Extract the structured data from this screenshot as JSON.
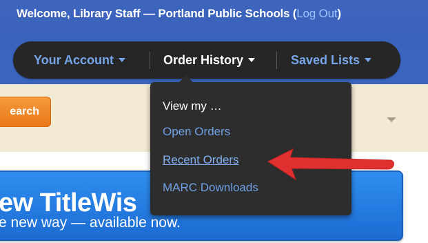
{
  "header": {
    "welcome_text": "Welcome, Library Staff — Portland Public Schools (",
    "logout_link": "Log Out",
    "close_paren": ")"
  },
  "nav": {
    "items": [
      {
        "label": "Your Account"
      },
      {
        "label": "Order History",
        "active": true
      },
      {
        "label": "Saved Lists"
      }
    ]
  },
  "dropdown": {
    "heading": "View my …",
    "items": [
      {
        "label": "Open Orders"
      },
      {
        "label": "Recent Orders",
        "highlighted": true
      },
      {
        "label": "MARC Downloads"
      }
    ]
  },
  "search": {
    "button_label": "earch"
  },
  "banner": {
    "title": "ew TitleWis",
    "subtitle": "e new way — available now."
  },
  "colors": {
    "header_blue": "#3a62bb",
    "nav_dark": "#262626",
    "link_blue": "#76a5e8",
    "orange": "#e9781a",
    "banner_blue": "#1c6bd3",
    "annotation_red": "#e03030"
  },
  "icons": {
    "nav_caret": "chevron-down-icon",
    "annotation": "red-arrow-icon"
  }
}
